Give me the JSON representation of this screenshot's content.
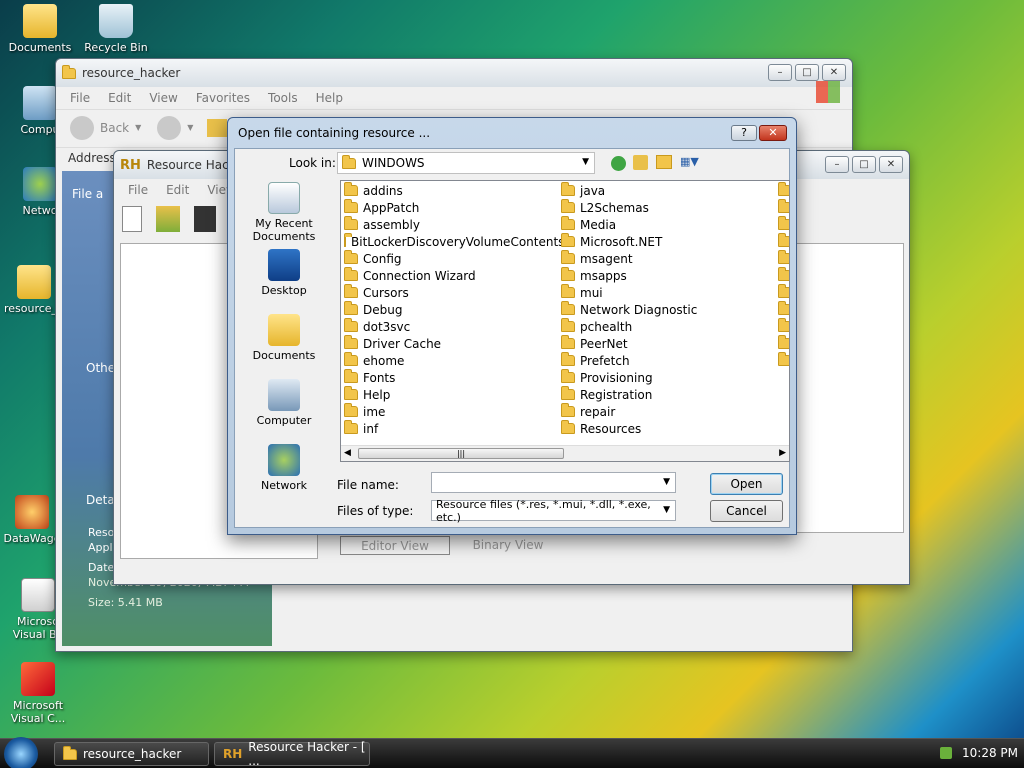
{
  "desktop": {
    "icons": [
      {
        "label": "Documents"
      },
      {
        "label": "Recycle Bin"
      },
      {
        "label": "Compu"
      },
      {
        "label": "Netwo"
      },
      {
        "label": "resource_h"
      },
      {
        "label": "DataWage"
      },
      {
        "label": "Microso Visual Ba"
      },
      {
        "label": "Microsoft Visual C..."
      }
    ]
  },
  "explorer": {
    "title": "resource_hacker",
    "menu": [
      "File",
      "Edit",
      "View",
      "Favorites",
      "Tools",
      "Help"
    ],
    "back_label": "Back",
    "address_label": "Address",
    "side_heading_1": "File a",
    "side_heading_2": "Othe",
    "side_heading_3": "Detai",
    "details_name": "Reso Appl",
    "details_date_label": "Date",
    "details_date": "November 19, 2020, 7:27 PM",
    "details_size": "Size: 5.41 MB"
  },
  "reshacker": {
    "title": "Resource Hacke",
    "menu": [
      "File",
      "Edit",
      "View"
    ],
    "tab_editor": "Editor View",
    "tab_binary": "Binary View"
  },
  "dialog": {
    "title": "Open file containing resource ...",
    "help_btn": "?",
    "look_in_label": "Look in:",
    "look_in_value": "WINDOWS",
    "places": [
      "My Recent Documents",
      "Desktop",
      "Documents",
      "Computer",
      "Network"
    ],
    "col1": [
      "addins",
      "AppPatch",
      "assembly",
      "BitLockerDiscoveryVolumeContents",
      "Config",
      "Connection Wizard",
      "Cursors",
      "Debug",
      "dot3svc",
      "Driver Cache",
      "ehome",
      "Fonts",
      "Help",
      "ime",
      "inf"
    ],
    "col2": [
      "java",
      "L2Schemas",
      "Media",
      "Microsoft.NET",
      "msagent",
      "msapps",
      "mui",
      "Network Diagnostic",
      "pchealth",
      "PeerNet",
      "Prefetch",
      "Provisioning",
      "Registration",
      "repair",
      "Resources"
    ],
    "file_name_label": "File name:",
    "file_name_value": "",
    "files_of_type_label": "Files of type:",
    "files_of_type_value": "Resource files (*.res, *.mui, *.dll, *.exe, etc.)",
    "open_btn": "Open",
    "cancel_btn": "Cancel"
  },
  "taskbar": {
    "task1": "resource_hacker",
    "task2": "Resource Hacker - [ ...",
    "clock": "10:28 PM"
  }
}
